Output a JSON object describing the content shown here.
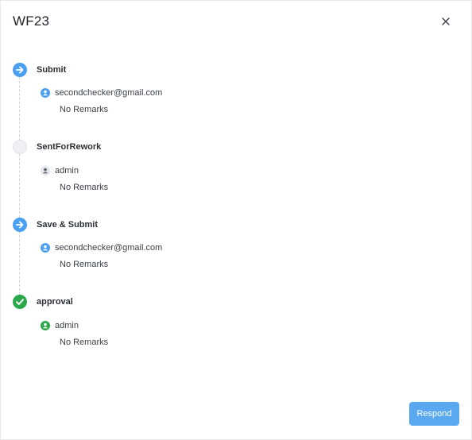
{
  "dialog": {
    "title": "WF23",
    "respond_label": "Respond"
  },
  "colors": {
    "accent_blue": "#4a9ff0",
    "success_green": "#2aa84a",
    "pending_gray": "#eef0f3",
    "user_gray": "#e4e6ea"
  },
  "steps": [
    {
      "title": "Submit",
      "status": "forward",
      "icon": "arrow-right-icon",
      "user": "secondchecker@gmail.com",
      "user_icon": "user-icon-blue",
      "remarks": "No Remarks"
    },
    {
      "title": "SentForRework",
      "status": "pending",
      "icon": "circle-icon",
      "user": "admin",
      "user_icon": "user-icon-gray",
      "remarks": "No Remarks"
    },
    {
      "title": "Save & Submit",
      "status": "forward",
      "icon": "arrow-right-icon",
      "user": "secondchecker@gmail.com",
      "user_icon": "user-icon-blue",
      "remarks": "No Remarks"
    },
    {
      "title": "approval",
      "status": "approved",
      "icon": "check-icon",
      "user": "admin",
      "user_icon": "user-icon-green",
      "remarks": "No Remarks"
    }
  ]
}
